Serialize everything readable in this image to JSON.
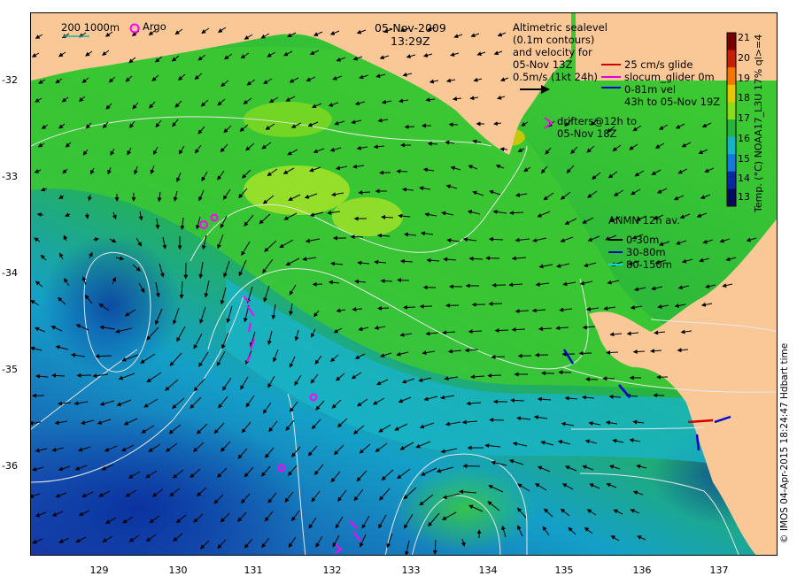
{
  "title": {
    "date": "05-Nov-2009",
    "time": "13:29Z"
  },
  "legend_top_left": {
    "isobaths": "200  1000m",
    "argo_label": "Argo"
  },
  "altimetry_note": {
    "line1": "Altimetric sealevel",
    "line2": "(0.1m contours)",
    "line3": "and velocity for",
    "line4": "05-Nov 13Z",
    "line5": "0.5m/s (1kt 24h)"
  },
  "glider_legend": {
    "glide": "25 cm/s glide",
    "surface": "slocum_glider 0m",
    "vel": "0-81m vel",
    "window": "43h to 05-Nov 19Z",
    "colors": {
      "glide": "#d00000",
      "surface": "#e000e0",
      "vel": "#0000cc"
    }
  },
  "drifters_legend": {
    "line1": "drifters@12h to",
    "line2": "05-Nov 18Z",
    "color": "#ff00ff"
  },
  "anmn_legend": {
    "title": "ANMN 12h av.",
    "items": [
      {
        "label": "0-30m",
        "color": "#000000"
      },
      {
        "label": "30-80m",
        "color": "#0000cc"
      },
      {
        "label": "80-150m",
        "color": "#00e0e0"
      }
    ]
  },
  "colorbar": {
    "label": "Temp. (°C) NOAA17_L3U 17% ql>=4",
    "ticks": [
      "21",
      "20",
      "19",
      "18",
      "17",
      "16",
      "15",
      "14",
      "13"
    ],
    "colors": [
      "#7a0000",
      "#c81e00",
      "#f07800",
      "#e6c800",
      "#8cdc1e",
      "#28b43c",
      "#14b4c8",
      "#1478dc",
      "#0a28a0",
      "#060a5a"
    ]
  },
  "axes": {
    "x_ticks": [
      "129",
      "130",
      "131",
      "132",
      "133",
      "134",
      "135",
      "136",
      "137"
    ],
    "y_ticks": [
      "-32",
      "-33",
      "-34",
      "-35",
      "-36"
    ]
  },
  "credit": "© IMOS 04-Apr-2015 18:24:47 Hdbart time",
  "colors": {
    "land": "#fac896",
    "contour": "#e8e8e8",
    "drifter": "#ff00ff"
  }
}
